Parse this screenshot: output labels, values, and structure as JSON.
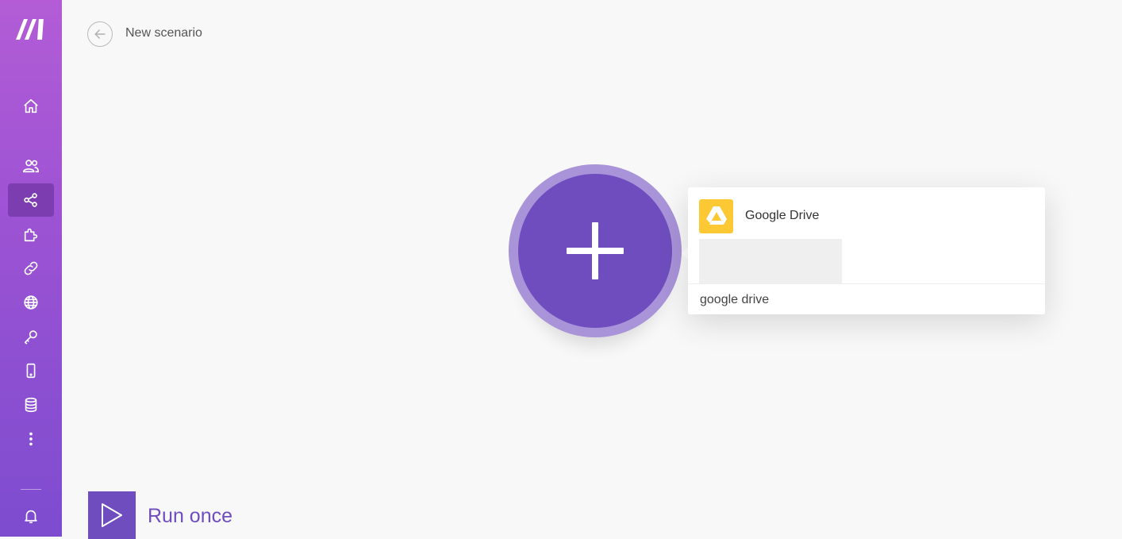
{
  "header": {
    "title": "New scenario"
  },
  "sidebar": {
    "logo": "make-logo",
    "items": [
      {
        "icon": "home-icon",
        "active": false
      },
      {
        "icon": "team-icon",
        "active": false
      },
      {
        "icon": "share-icon",
        "active": true
      },
      {
        "icon": "puzzle-icon",
        "active": false
      },
      {
        "icon": "link-icon",
        "active": false
      },
      {
        "icon": "globe-icon",
        "active": false
      },
      {
        "icon": "key-icon",
        "active": false
      },
      {
        "icon": "mobile-icon",
        "active": false
      },
      {
        "icon": "database-icon",
        "active": false
      },
      {
        "icon": "more-icon",
        "active": false
      },
      {
        "icon": "bell-icon",
        "active": false
      }
    ]
  },
  "module_picker": {
    "results": [
      {
        "label": "Google Drive",
        "icon": "google-drive-icon",
        "badge_color": "#fcc934"
      }
    ],
    "search_value": "google drive"
  },
  "toolbar": {
    "run_label": "Run once"
  },
  "colors": {
    "accent": "#6f4dbe",
    "halo": "#a993d9",
    "sidebar_top": "#b35cd6",
    "sidebar_bottom": "#7d4ccf"
  }
}
